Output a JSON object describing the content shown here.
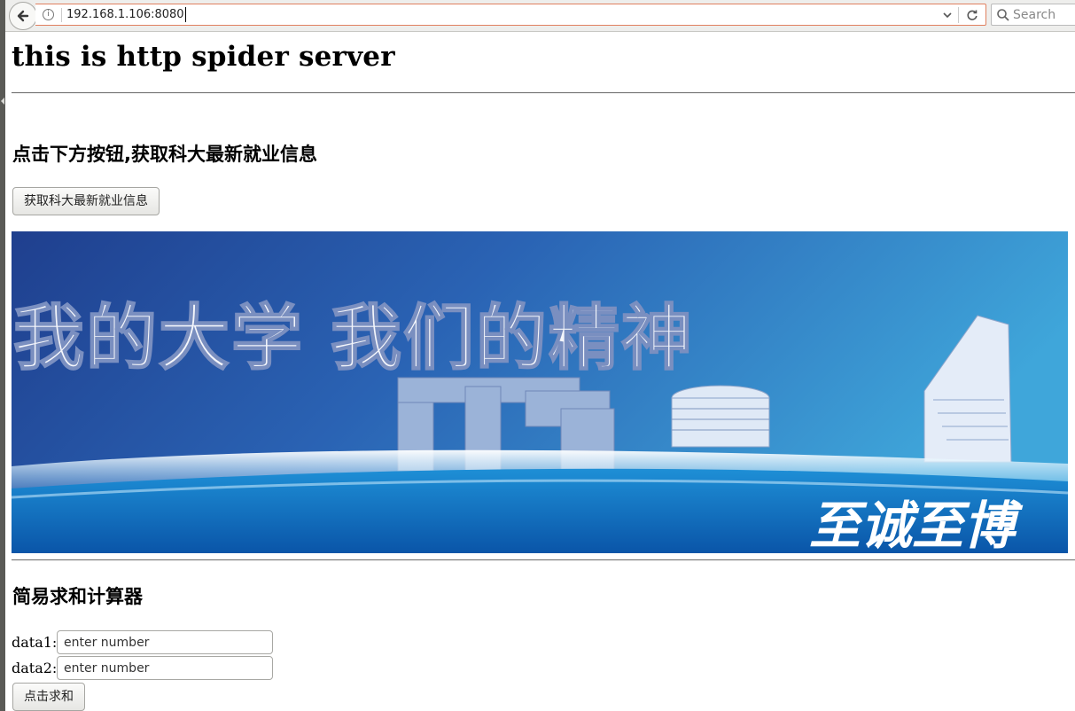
{
  "browser": {
    "url": "192.168.1.106:8080",
    "search_placeholder": "Search"
  },
  "page": {
    "title": "this is http spider server",
    "jobs_heading": "点击下方按钮,获取科大最新就业信息",
    "jobs_button": "获取科大最新就业信息",
    "banner": {
      "slogan": "我的大学  我们的精神",
      "motto": "至诚至博"
    },
    "calculator_heading": "简易求和计算器",
    "data1_label": "data1:",
    "data2_label": "data2:",
    "input_placeholder": "enter number",
    "sum_button": "点击求和"
  }
}
